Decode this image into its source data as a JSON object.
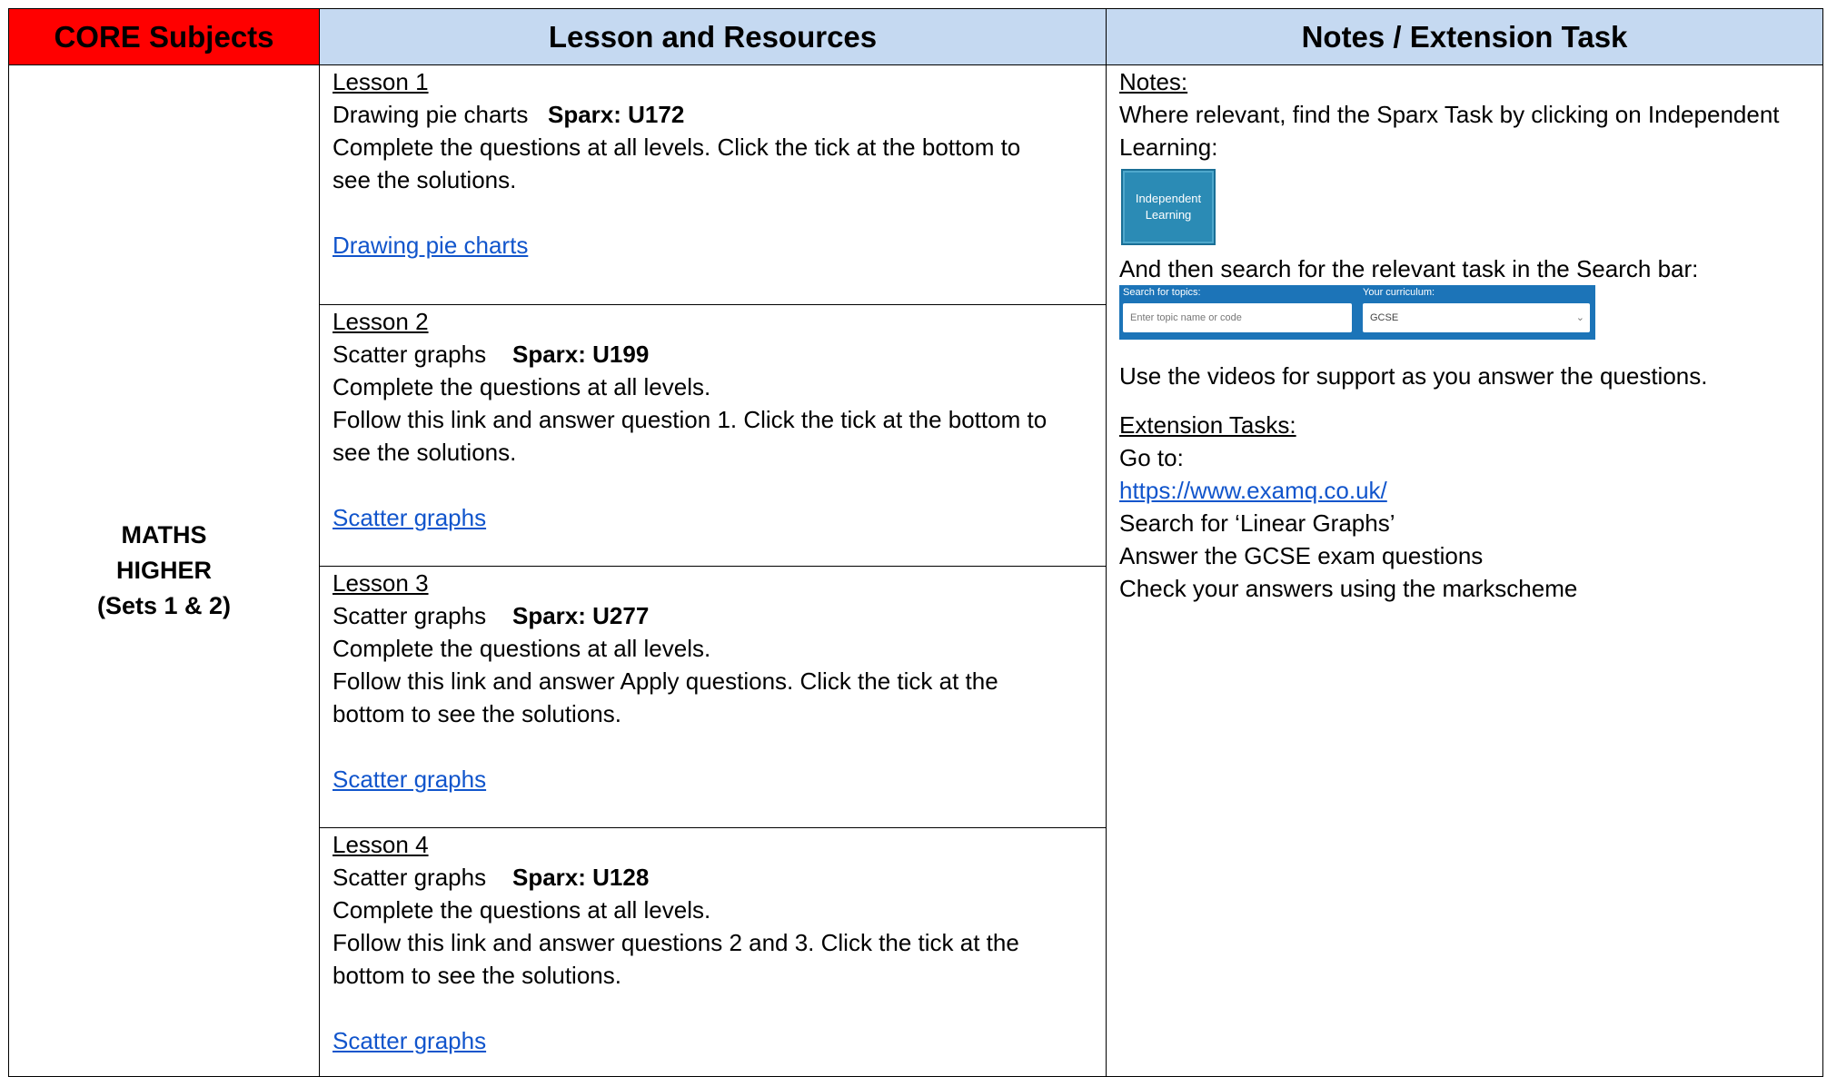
{
  "header": {
    "core": "CORE Subjects",
    "lesson": "Lesson and Resources",
    "notes": "Notes / Extension Task"
  },
  "subject": {
    "line1": "MATHS",
    "line2": "HIGHER",
    "line3": "(Sets 1 & 2)"
  },
  "lessons": [
    {
      "title": "Lesson 1",
      "topic": "Drawing pie charts",
      "sparx": "Sparx: U172",
      "lines": [
        "Complete the questions at all levels. Click the tick at the bottom to",
        "see the solutions."
      ],
      "link": "Drawing pie charts"
    },
    {
      "title": "Lesson 2",
      "topic": "Scatter graphs",
      "sparx": "Sparx: U199",
      "lines": [
        "Complete the questions at all levels.",
        "Follow this link and answer question 1. Click the tick at the bottom to",
        "see the solutions."
      ],
      "link": "Scatter graphs"
    },
    {
      "title": "Lesson 3",
      "topic": "Scatter graphs",
      "sparx": "Sparx: U277",
      "lines": [
        "Complete the questions at all levels.",
        "Follow this link and answer Apply questions. Click the tick at the",
        "bottom to see the solutions."
      ],
      "link": "Scatter graphs"
    },
    {
      "title": "Lesson 4",
      "topic": "Scatter graphs",
      "sparx": "Sparx: U128",
      "lines": [
        "Complete the questions at all levels.",
        "Follow this link and answer questions 2 and 3. Click the tick at the",
        "bottom to see the solutions."
      ],
      "link": "Scatter graphs"
    }
  ],
  "notes": {
    "heading": "Notes:",
    "intro_line1": "Where relevant, find the Sparx Task by clicking on Independent",
    "intro_line2": "Learning:",
    "il_button_line1": "Independent",
    "il_button_line2": "Learning",
    "search_intro": "And then search for the relevant task in the Search bar:",
    "search_topics_label": "Search for topics:",
    "search_topics_placeholder": "Enter topic name or code",
    "curriculum_label": "Your curriculum:",
    "curriculum_value": "GCSE",
    "videos": "Use the videos for support as you answer the questions.",
    "ext_heading": "Extension Tasks:",
    "go_to": "Go to:",
    "url": "https://www.examq.co.uk/",
    "search_for": "Search for ‘Linear Graphs’",
    "answer": "Answer the GCSE exam questions",
    "check": "Check your answers using the markscheme"
  }
}
